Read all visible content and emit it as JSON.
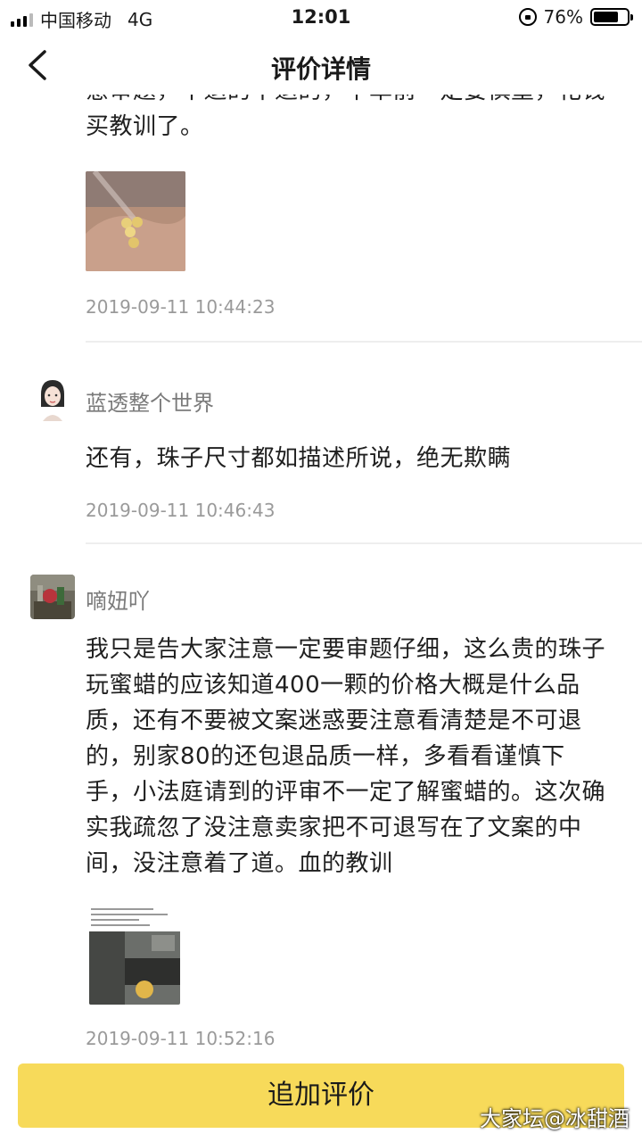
{
  "status_bar": {
    "carrier": "中国移动",
    "network": "4G",
    "time": "12:01",
    "battery": "76%",
    "battery_level": 0.76
  },
  "header": {
    "title": "评价详情"
  },
  "comments": [
    {
      "text": "意审题，不退的不退的，下单前一定要慎重，花钱买教训了。",
      "timestamp": "2019-09-11 10:44:23"
    },
    {
      "username": "蓝透整个世界",
      "text": "还有，珠子尺寸都如描述所说，绝无欺瞒",
      "timestamp": "2019-09-11 10:46:43"
    },
    {
      "username": "嘀妞吖",
      "text": "我只是告大家注意一定要审题仔细，这么贵的珠子玩蜜蜡的应该知道400一颗的价格大概是什么品质，还有不要被文案迷惑要注意看清楚是不可退的，别家80的还包退品质一样，多看看谨慎下手，小法庭请到的评审不一定了解蜜蜡的。这次确实我疏忽了没注意卖家把不可退写在了文案的中间，没注意着了道。血的教训",
      "timestamp": "2019-09-11 10:52:16"
    }
  ],
  "bottom": {
    "add_review_label": "追加评价"
  },
  "watermark": "大家坛@冰甜酒"
}
